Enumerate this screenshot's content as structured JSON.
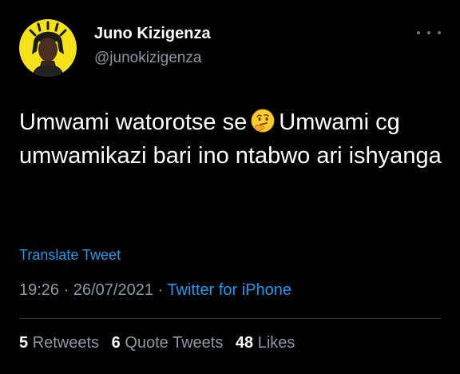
{
  "author": {
    "display_name": "Juno Kizigenza",
    "handle": "@junokizigenza",
    "avatar_icon": "profile-photo"
  },
  "more_icon": "more-horizontal-icon",
  "tweet": {
    "text_part1": "Umwami watorotse se",
    "emoji": "thinking-face-emoji",
    "text_part2": "Umwami cg umwamikazi bari ino ntabwo ari ishyanga"
  },
  "translate_label": "Translate Tweet",
  "meta": {
    "time": "19:26",
    "date": "26/07/2021",
    "separator": "·",
    "source": "Twitter for iPhone"
  },
  "stats": {
    "retweets_count": "5",
    "retweets_label": "Retweets",
    "quotes_count": "6",
    "quotes_label": "Quote Tweets",
    "likes_count": "48",
    "likes_label": "Likes"
  },
  "colors": {
    "background": "#000000",
    "text": "#ffffff",
    "secondary": "#8b98a5",
    "accent": "#1d9bf0",
    "avatar_bg": "#f5e21b"
  }
}
